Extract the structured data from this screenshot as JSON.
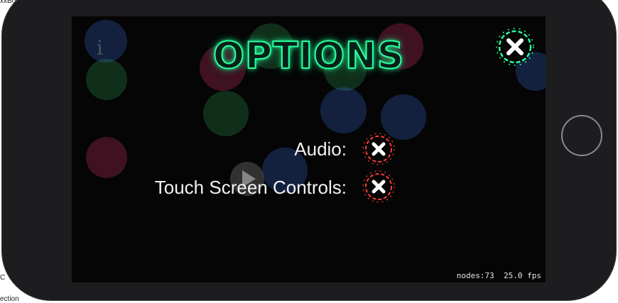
{
  "window": {
    "top_label": "xxBo",
    "left_label": "C",
    "bottom_label": "ection"
  },
  "game": {
    "title": "OPTIONS",
    "close_icon": "close-icon",
    "info_icon": "info-icon",
    "play_icon": "play-icon",
    "options": [
      {
        "label": "Audio:",
        "state": "off",
        "icon": "close-icon"
      },
      {
        "label": "Touch Screen Controls:",
        "state": "off",
        "icon": "close-icon"
      }
    ],
    "stats": {
      "nodes": "nodes:73",
      "fps": "25.0 fps"
    }
  },
  "colors": {
    "title_glow": "#2aff9c",
    "close_outline": "#2aff9c",
    "toggle_outline": "#ff3b3b",
    "screen_bg": "#050505",
    "device_body": "#1d1d1f"
  }
}
